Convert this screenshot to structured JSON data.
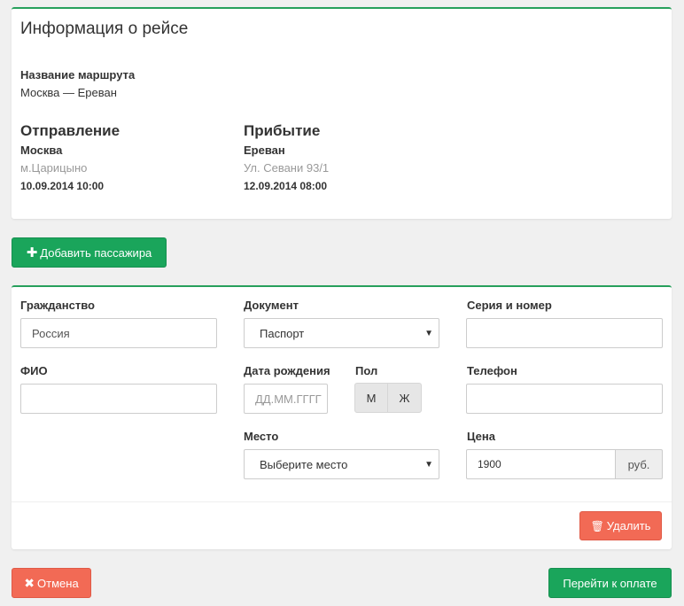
{
  "trip_info": {
    "title": "Информация о рейсе",
    "route_label": "Название маршрута",
    "route_value": "Москва — Ереван",
    "departure": {
      "heading": "Отправление",
      "city": "Москва",
      "station": "м.Царицыно",
      "datetime": "10.09.2014 10:00"
    },
    "arrival": {
      "heading": "Прибытие",
      "city": "Ереван",
      "station": "Ул. Севани 93/1",
      "datetime": "12.09.2014 08:00"
    }
  },
  "add_passenger_button": {
    "icon": "plus-icon",
    "label": "Добавить пассажира"
  },
  "passenger_form": {
    "citizenship": {
      "label": "Гражданство",
      "placeholder": "Россия"
    },
    "document": {
      "label": "Документ",
      "selected": "Паспорт"
    },
    "doc_number": {
      "label": "Серия и номер",
      "value": ""
    },
    "full_name": {
      "label": "ФИО",
      "value": ""
    },
    "birth_date": {
      "label": "Дата рождения",
      "placeholder": "ДД.ММ.ГГГГ"
    },
    "gender": {
      "label": "Пол",
      "options": [
        "М",
        "Ж"
      ]
    },
    "phone": {
      "label": "Телефон",
      "value": ""
    },
    "seat": {
      "label": "Место",
      "selected": "Выберите место"
    },
    "price": {
      "label": "Цена",
      "value": "1900",
      "unit": "руб."
    },
    "delete_button": {
      "icon": "trash-icon",
      "label": "Удалить"
    }
  },
  "footer": {
    "cancel_button": {
      "icon": "times-icon",
      "label": "Отмена"
    },
    "pay_button": {
      "label": "Перейти к оплате"
    }
  },
  "colors": {
    "accent_green": "#1aa55b",
    "danger_red": "#f26a55",
    "panel_border": "#27a05c"
  }
}
